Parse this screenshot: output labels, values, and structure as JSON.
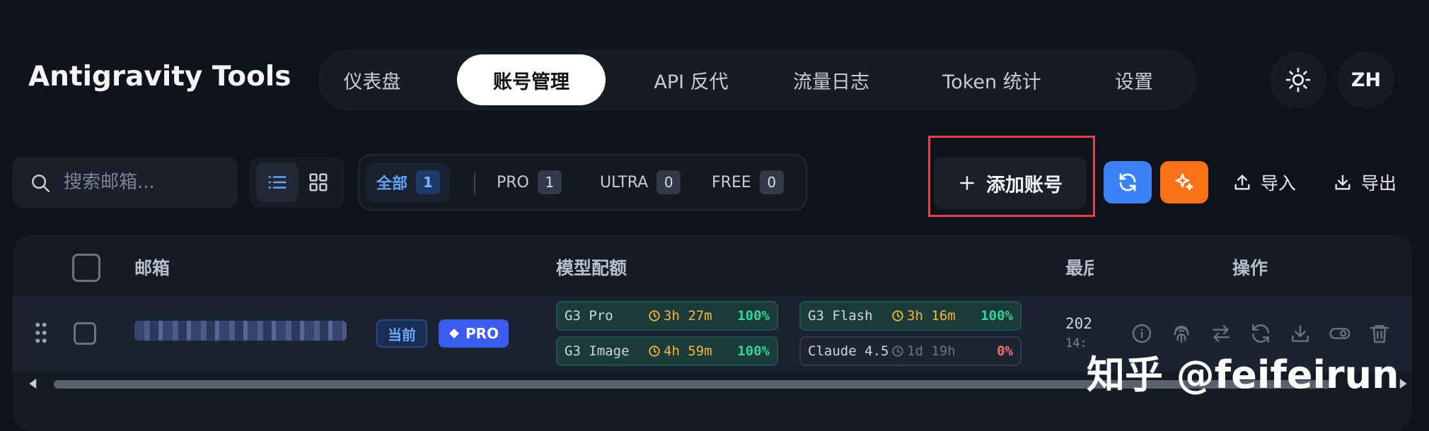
{
  "app": {
    "title": "Antigravity Tools"
  },
  "nav": {
    "tabs": [
      {
        "label": "仪表盘",
        "active": false
      },
      {
        "label": "账号管理",
        "active": true
      },
      {
        "label": "API 反代",
        "active": false
      },
      {
        "label": "流量日志",
        "active": false
      },
      {
        "label": "Token 统计",
        "active": false
      },
      {
        "label": "设置",
        "active": false
      }
    ]
  },
  "header": {
    "theme_icon": "sun-icon",
    "language": "ZH"
  },
  "toolbar": {
    "search_placeholder": "搜索邮箱...",
    "view_modes": [
      "list-icon",
      "grid-icon"
    ],
    "filters": [
      {
        "label": "全部",
        "count": "1",
        "active": true
      },
      {
        "label": "PRO",
        "count": "1",
        "active": false
      },
      {
        "label": "ULTRA",
        "count": "0",
        "active": false
      },
      {
        "label": "FREE",
        "count": "0",
        "active": false
      }
    ],
    "add_label": "添加账号",
    "refresh_color": "#3b82f6",
    "magic_color": "#f97316",
    "import_label": "导入",
    "export_label": "导出"
  },
  "table": {
    "headers": {
      "email": "邮箱",
      "quota": "模型配额",
      "last": "最后",
      "actions": "操作"
    },
    "rows": [
      {
        "current_label": "当前",
        "tier_label": "PRO",
        "quotas": [
          {
            "name": "G3 Pro",
            "time": "3h 27m",
            "pct": "100%"
          },
          {
            "name": "G3 Flash",
            "time": "3h 16m",
            "pct": "100%"
          },
          {
            "name": "G3 Image",
            "time": "4h 59m",
            "pct": "100%"
          },
          {
            "name": "Claude 4.5",
            "time": "1d 19h",
            "pct": "0%"
          }
        ],
        "date_line1": "202",
        "date_line2": "14:",
        "actions": [
          "info-icon",
          "fingerprint-icon",
          "switch-icon",
          "refresh-icon",
          "download-icon",
          "toggle-icon",
          "trash-icon"
        ]
      }
    ]
  },
  "watermark": "知乎 @feifeirun"
}
